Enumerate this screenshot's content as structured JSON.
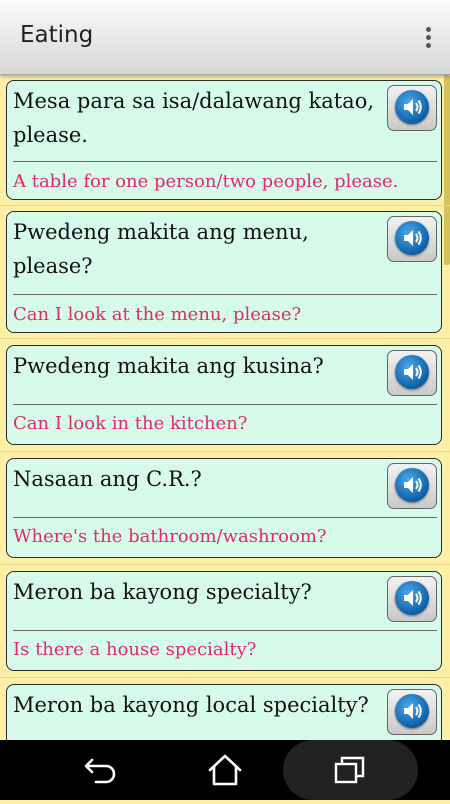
{
  "app": {
    "title": "Eating"
  },
  "phrases": [
    {
      "phrase": "Mesa para sa isa/dalawang katao, please.",
      "translation": "A table for one person/two people, please."
    },
    {
      "phrase": "Pwedeng makita ang menu, please?",
      "translation": "Can I look at the menu, please?"
    },
    {
      "phrase": "Pwedeng makita ang kusina?",
      "translation": "Can I look in the kitchen?"
    },
    {
      "phrase": "Nasaan ang C.R.?",
      "translation": "Where's the bathroom/washroom?"
    },
    {
      "phrase": "Meron ba kayong specialty?",
      "translation": "Is there a house specialty?"
    },
    {
      "phrase": "Meron ba kayong local specialty?",
      "translation": ""
    }
  ],
  "icons": {
    "sound": "speaker-icon",
    "menu": "more-vert-icon",
    "back": "back-icon",
    "home": "home-icon",
    "recents": "recents-icon"
  },
  "colors": {
    "background": "#fdf0a6",
    "card": "#d6fbeb",
    "translation": "#e02a6a"
  }
}
